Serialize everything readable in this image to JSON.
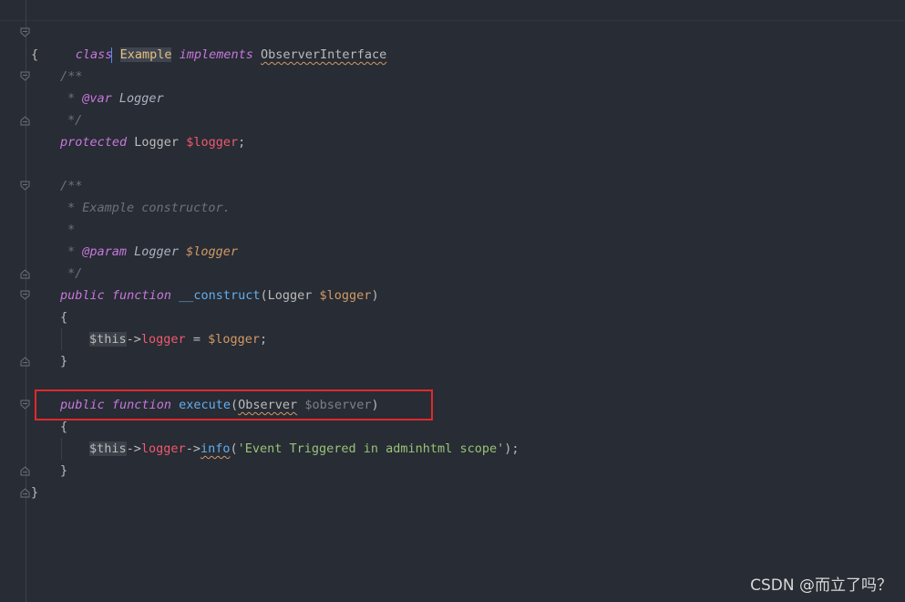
{
  "editor": {
    "theme_colors": {
      "background": "#282c34",
      "keyword": "#c678dd",
      "class_name": "#e5c07b",
      "variable": "#ef596f",
      "parameter": "#d19a66",
      "function": "#61afef",
      "string": "#98c379",
      "comment": "#6b7280",
      "highlight_box": "#e0292b"
    },
    "lines": [
      {
        "t1": "class",
        "t2": " ",
        "t3": "Example",
        "t4": " ",
        "t5": "implements",
        "t6": " ",
        "t7": "ObserverInterface"
      },
      {
        "t1": "{"
      },
      {
        "t1": "/**"
      },
      {
        "t1": "* ",
        "t2": "@var",
        "t3": " Logger"
      },
      {
        "t1": "*/"
      },
      {
        "t1": "protected",
        "t2": " Logger ",
        "t3": "$logger",
        "t4": ";"
      },
      {},
      {
        "t1": "/**"
      },
      {
        "t1": "* Example constructor."
      },
      {
        "t1": "*"
      },
      {
        "t1": "* ",
        "t2": "@param",
        "t3": " Logger ",
        "t4": "$logger"
      },
      {
        "t1": "*/"
      },
      {
        "t1": "public",
        "t2": " ",
        "t3": "function",
        "t4": " ",
        "t5": "__construct",
        "t6": "(Logger ",
        "t7": "$logger",
        "t8": ")"
      },
      {
        "t1": "{"
      },
      {
        "t1": "$this",
        "t2": "->",
        "t3": "logger",
        "t4": " = ",
        "t5": "$logger",
        "t6": ";"
      },
      {
        "t1": "}"
      },
      {},
      {
        "t1": "public",
        "t2": " ",
        "t3": "function",
        "t4": " ",
        "t5": "execute",
        "t6": "(",
        "t7": "Observer",
        "t8": " ",
        "t9": "$observer",
        "t10": ")"
      },
      {
        "t1": "{"
      },
      {
        "t1": "$this",
        "t2": "->",
        "t3": "logger",
        "t4": "->",
        "t5": "info",
        "t6": "(",
        "t7": "'Event Triggered in adminhtml scope'",
        "t8": ");"
      },
      {
        "t1": "}"
      },
      {
        "t1": "}"
      }
    ],
    "fold_markers": [
      "fold-open",
      "fold-open",
      "fold-close",
      "fold-open",
      "fold-close",
      "fold-open",
      "fold-close",
      "fold-open",
      "fold-close",
      "fold-close"
    ]
  },
  "watermark": {
    "text": "CSDN @而立了吗？"
  }
}
